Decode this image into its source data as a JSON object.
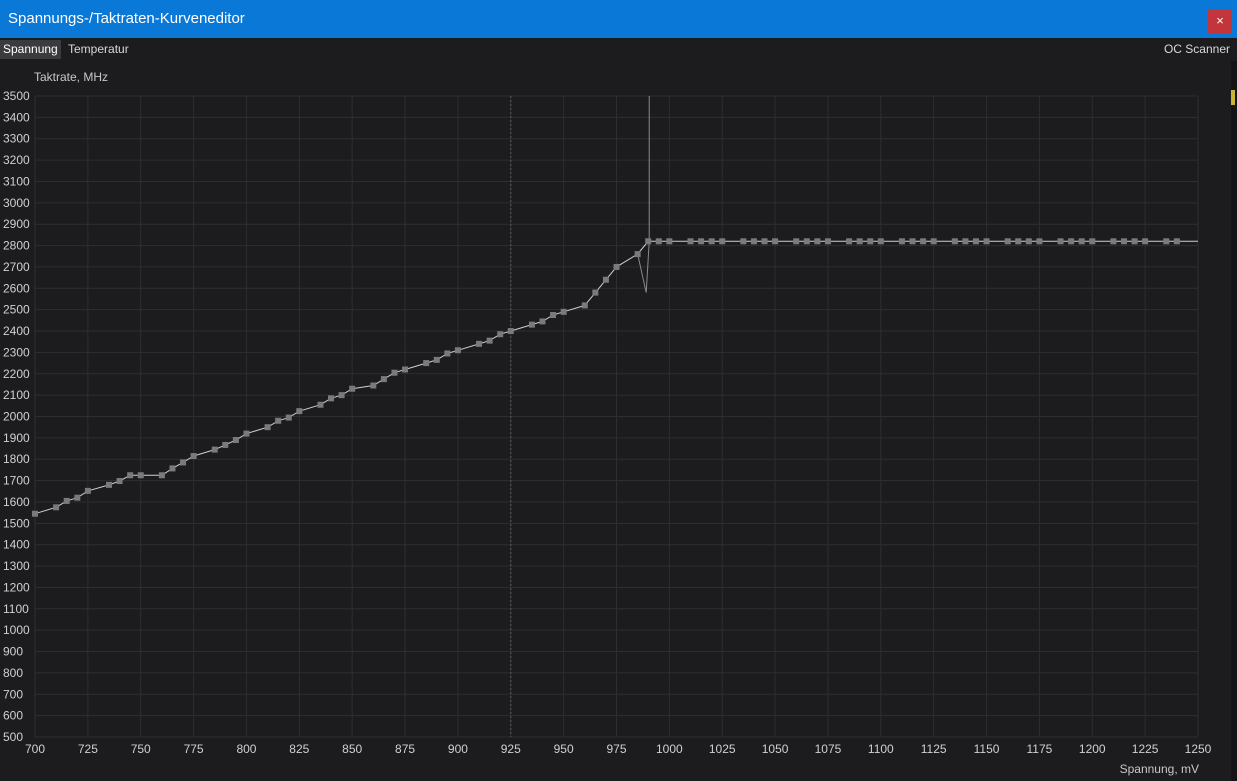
{
  "window": {
    "title": "Spannungs-/Taktraten-Kurveneditor",
    "close_label": "×"
  },
  "tabs": [
    {
      "label": "Spannung",
      "active": true
    },
    {
      "label": "Temperatur",
      "active": false
    }
  ],
  "oc_scanner_label": "OC Scanner",
  "colors": {
    "titlebar": "#0a78d7",
    "background": "#1c1c1e",
    "grid": "#2e2e31",
    "curve_line": "#d0d0d0",
    "point": "#7a7a7a"
  },
  "chart_data": {
    "type": "line",
    "xlabel": "Spannung, mV",
    "ylabel": "Taktrate, MHz",
    "xlim": [
      700,
      1250
    ],
    "ylim": [
      500,
      3500
    ],
    "x_ticks": [
      700,
      725,
      750,
      775,
      800,
      825,
      850,
      875,
      900,
      925,
      950,
      975,
      1000,
      1025,
      1050,
      1075,
      1100,
      1125,
      1150,
      1175,
      1200,
      1225,
      1250
    ],
    "y_ticks": [
      500,
      600,
      700,
      800,
      900,
      1000,
      1100,
      1200,
      1300,
      1400,
      1500,
      1600,
      1700,
      1800,
      1900,
      2000,
      2100,
      2200,
      2300,
      2400,
      2500,
      2600,
      2700,
      2800,
      2900,
      3000,
      3100,
      3200,
      3300,
      3400,
      3500
    ],
    "grid": true,
    "current_voltage_marker": 925,
    "spike": {
      "x": 990,
      "y_top": 3500,
      "y_dip": 2580
    },
    "series": [
      {
        "x": [
          700,
          710,
          715,
          720,
          725,
          735,
          740,
          745,
          750,
          760,
          765,
          770,
          775,
          785,
          790,
          795,
          800,
          810,
          815,
          820,
          825,
          835,
          840,
          845,
          850,
          860,
          865,
          870,
          875,
          885,
          890,
          895,
          900,
          910,
          915,
          920,
          925,
          935,
          940,
          945,
          950,
          960,
          965,
          970,
          975,
          985,
          990,
          995,
          1000,
          1010,
          1015,
          1020,
          1025,
          1035,
          1040,
          1045,
          1050,
          1060,
          1065,
          1070,
          1075,
          1085,
          1090,
          1095,
          1100,
          1110,
          1115,
          1120,
          1125,
          1135,
          1140,
          1145,
          1150,
          1160,
          1165,
          1170,
          1175,
          1185,
          1190,
          1195,
          1200,
          1210,
          1215,
          1220,
          1225,
          1235,
          1240
        ],
        "y": [
          1545,
          1575,
          1605,
          1620,
          1652,
          1680,
          1698,
          1725,
          1725,
          1725,
          1757,
          1785,
          1815,
          1845,
          1867,
          1890,
          1920,
          1950,
          1980,
          1995,
          2025,
          2055,
          2085,
          2100,
          2130,
          2145,
          2175,
          2205,
          2220,
          2250,
          2265,
          2295,
          2310,
          2340,
          2355,
          2385,
          2400,
          2430,
          2445,
          2475,
          2490,
          2520,
          2580,
          2640,
          2700,
          2760,
          2820,
          2820,
          2820,
          2820,
          2820,
          2820,
          2820,
          2820,
          2820,
          2820,
          2820,
          2820,
          2820,
          2820,
          2820,
          2820,
          2820,
          2820,
          2820,
          2820,
          2820,
          2820,
          2820,
          2820,
          2820,
          2820,
          2820,
          2820,
          2820,
          2820,
          2820,
          2820,
          2820,
          2820,
          2820,
          2820,
          2820,
          2820,
          2820,
          2820,
          2820
        ]
      }
    ]
  }
}
